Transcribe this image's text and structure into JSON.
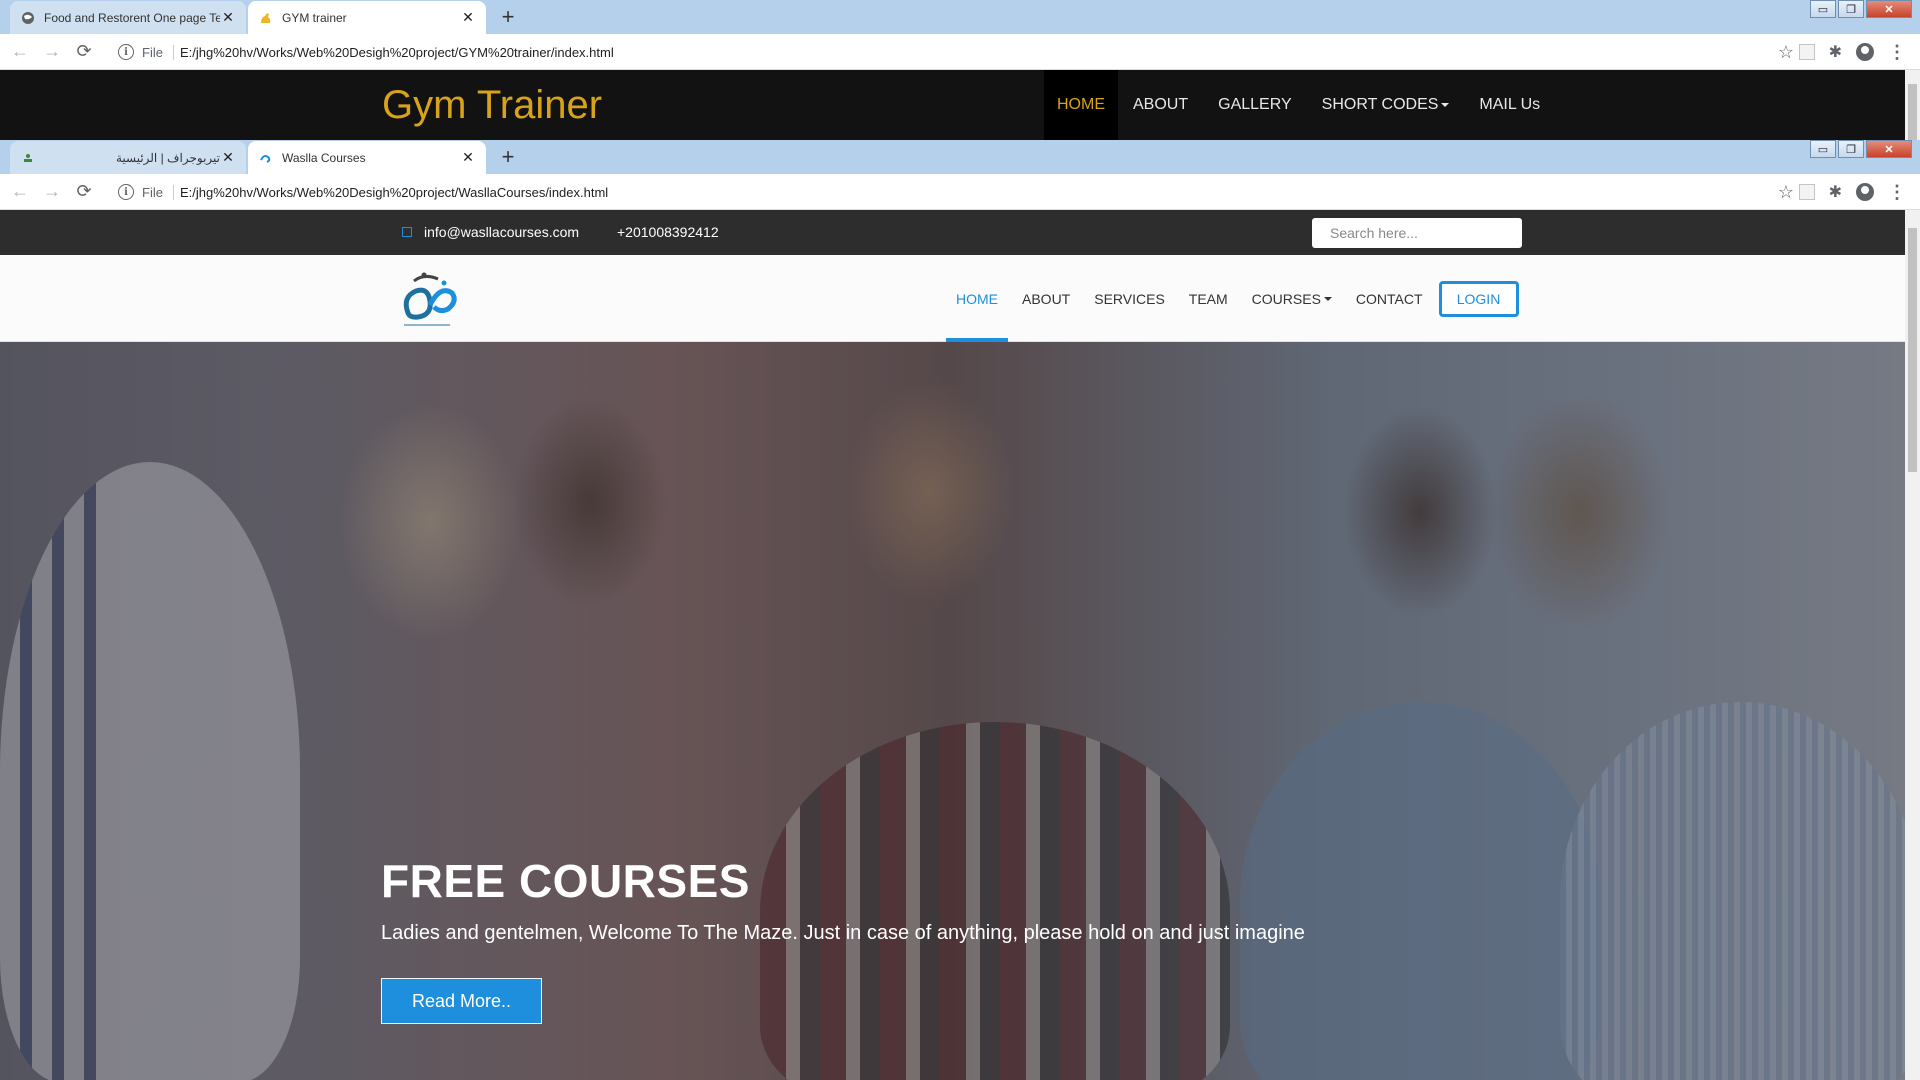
{
  "window1": {
    "tabs": [
      {
        "title": "Food and Restorent One page Te",
        "icon": "globe-icon",
        "active": false
      },
      {
        "title": "GYM trainer",
        "icon": "flex-arm-icon",
        "active": true
      }
    ],
    "url_scheme": "File",
    "url": "E:/jhg%20hv/Works/Web%20Desigh%20project/GYM%20trainer/index.html",
    "page": {
      "logo": "Gym Trainer",
      "nav": [
        "HOME",
        "ABOUT",
        "GALLERY",
        "SHORT CODES",
        "MAIL Us"
      ],
      "active_nav": "HOME",
      "accent": "#d8a319"
    }
  },
  "window2": {
    "tabs": [
      {
        "title": "تيربوجراف | الرئيسية",
        "icon": "page-icon",
        "active": false
      },
      {
        "title": "Waslla Courses",
        "icon": "waslla-icon",
        "active": true
      }
    ],
    "url_scheme": "File",
    "url": "E:/jhg%20hv/Works/Web%20Desigh%20project/WasllaCourses/index.html",
    "page": {
      "email": "info@wasllacourses.com",
      "phone": "+201008392412",
      "search_placeholder": "Search here...",
      "nav": [
        "HOME",
        "ABOUT",
        "SERVICES",
        "TEAM",
        "COURSES",
        "CONTACT"
      ],
      "active_nav": "HOME",
      "login": "LOGIN",
      "hero": {
        "title": "FREE COURSES",
        "subtitle": "Ladies and gentelmen, Welcome To The Maze. Just in case of anything, please hold on and just imagine",
        "button": "Read More.."
      },
      "accent": "#1d8fdc"
    }
  },
  "glyphs": {
    "close": "✕",
    "newtab": "+",
    "back": "←",
    "forward": "→",
    "reload": "⟳",
    "star": "☆",
    "puzzle": "✱",
    "menu": "⋮",
    "info": "i",
    "minimize": "▭",
    "restore": "❐"
  }
}
